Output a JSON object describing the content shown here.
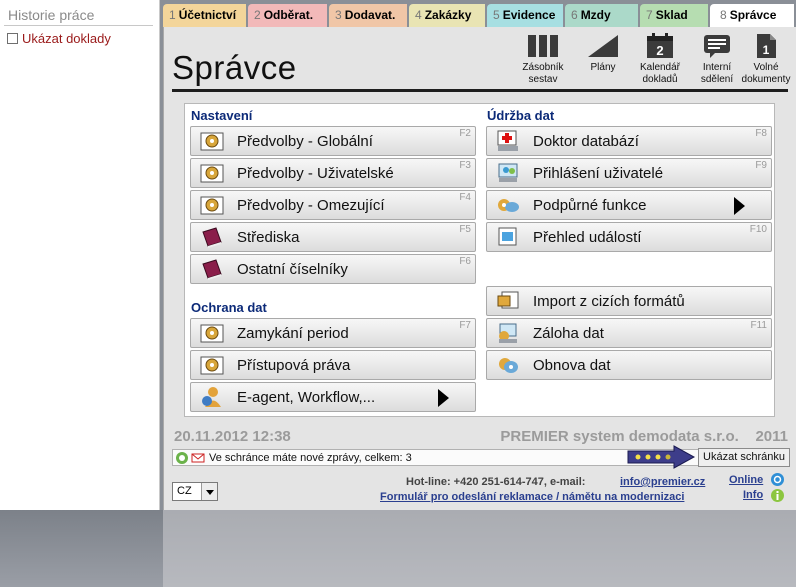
{
  "history": {
    "title": "Historie práce",
    "checkbox_label": "Ukázat doklady"
  },
  "tabs": [
    {
      "num": "1",
      "label": "Účetnictví",
      "color": "#f3d59a"
    },
    {
      "num": "2",
      "label": "Odběrat.",
      "color": "#f2b9b9"
    },
    {
      "num": "3",
      "label": "Dodavat.",
      "color": "#f0c6a7"
    },
    {
      "num": "4",
      "label": "Zakázky",
      "color": "#e9e4b3"
    },
    {
      "num": "5",
      "label": "Evidence",
      "color": "#a7dfe2"
    },
    {
      "num": "6",
      "label": "Mzdy",
      "color": "#abd9c9"
    },
    {
      "num": "7",
      "label": "Sklad",
      "color": "#b6ddb1"
    },
    {
      "num": "8",
      "label": "Správce",
      "color": "#ffffff"
    }
  ],
  "page": {
    "title": "Správce"
  },
  "toolbar": [
    {
      "line1": "Zásobník",
      "line2": "sestav",
      "icon": "columns-icon"
    },
    {
      "line1": "Plány",
      "line2": "",
      "icon": "chart-icon"
    },
    {
      "line1": "Kalendář",
      "line2": "dokladů",
      "icon": "calendar-icon",
      "day": "2"
    },
    {
      "line1": "Interní",
      "line2": "sdělení",
      "icon": "message-icon"
    },
    {
      "line1": "Volné",
      "line2": "dokumenty",
      "icon": "document-icon",
      "day": "1"
    }
  ],
  "sections": {
    "nastaveni": "Nastavení",
    "ochrana": "Ochrana dat",
    "udrzba": "Údržba dat"
  },
  "left_buttons": [
    {
      "label": "Předvolby - Globální",
      "fkey": "F2",
      "icon": "gear-icon"
    },
    {
      "label": "Předvolby - Uživatelské",
      "fkey": "F3",
      "icon": "gear-icon"
    },
    {
      "label": "Předvolby - Omezující",
      "fkey": "F4",
      "icon": "gear-icon"
    },
    {
      "label": "Střediska",
      "fkey": "F5",
      "icon": "book-icon"
    },
    {
      "label": "Ostatní číselníky",
      "fkey": "F6",
      "icon": "book-icon"
    },
    {
      "label": "Zamykání period",
      "fkey": "F7",
      "icon": "gear-icon"
    },
    {
      "label": "Přístupová práva",
      "fkey": "",
      "icon": "gear-icon"
    },
    {
      "label": "E-agent, Workflow,...",
      "fkey": "",
      "icon": "agent-icon",
      "arrow": true
    }
  ],
  "right_buttons": [
    {
      "label": "Doktor databází",
      "fkey": "F8",
      "icon": "doctor-icon"
    },
    {
      "label": "Přihlášení uživatelé",
      "fkey": "F9",
      "icon": "users-icon"
    },
    {
      "label": "Podpůrné funkce",
      "fkey": "",
      "icon": "tools-icon",
      "arrow": true
    },
    {
      "label": "Přehled událostí",
      "fkey": "F10",
      "icon": "events-icon"
    },
    {
      "label": "Import z cizích formátů",
      "fkey": "",
      "icon": "import-icon"
    },
    {
      "label": "Záloha dat",
      "fkey": "F11",
      "icon": "backup-icon"
    },
    {
      "label": "Obnova dat",
      "fkey": "",
      "icon": "restore-icon"
    }
  ],
  "footer": {
    "date": "20.11.2012  12:38",
    "company": "PREMIER system demodata s.r.o.    2011",
    "message": "Ve schránce máte nové zprávy, celkem: 3",
    "show_inbox": "Ukázat schránku",
    "lang": "CZ",
    "hotline": "Hot-line: +420 251-614-747, e-mail:",
    "email": "info@premier.cz",
    "form_link": "Formulář pro odeslání reklamace / námětu na modernizaci",
    "online": "Online",
    "info": "Info"
  }
}
